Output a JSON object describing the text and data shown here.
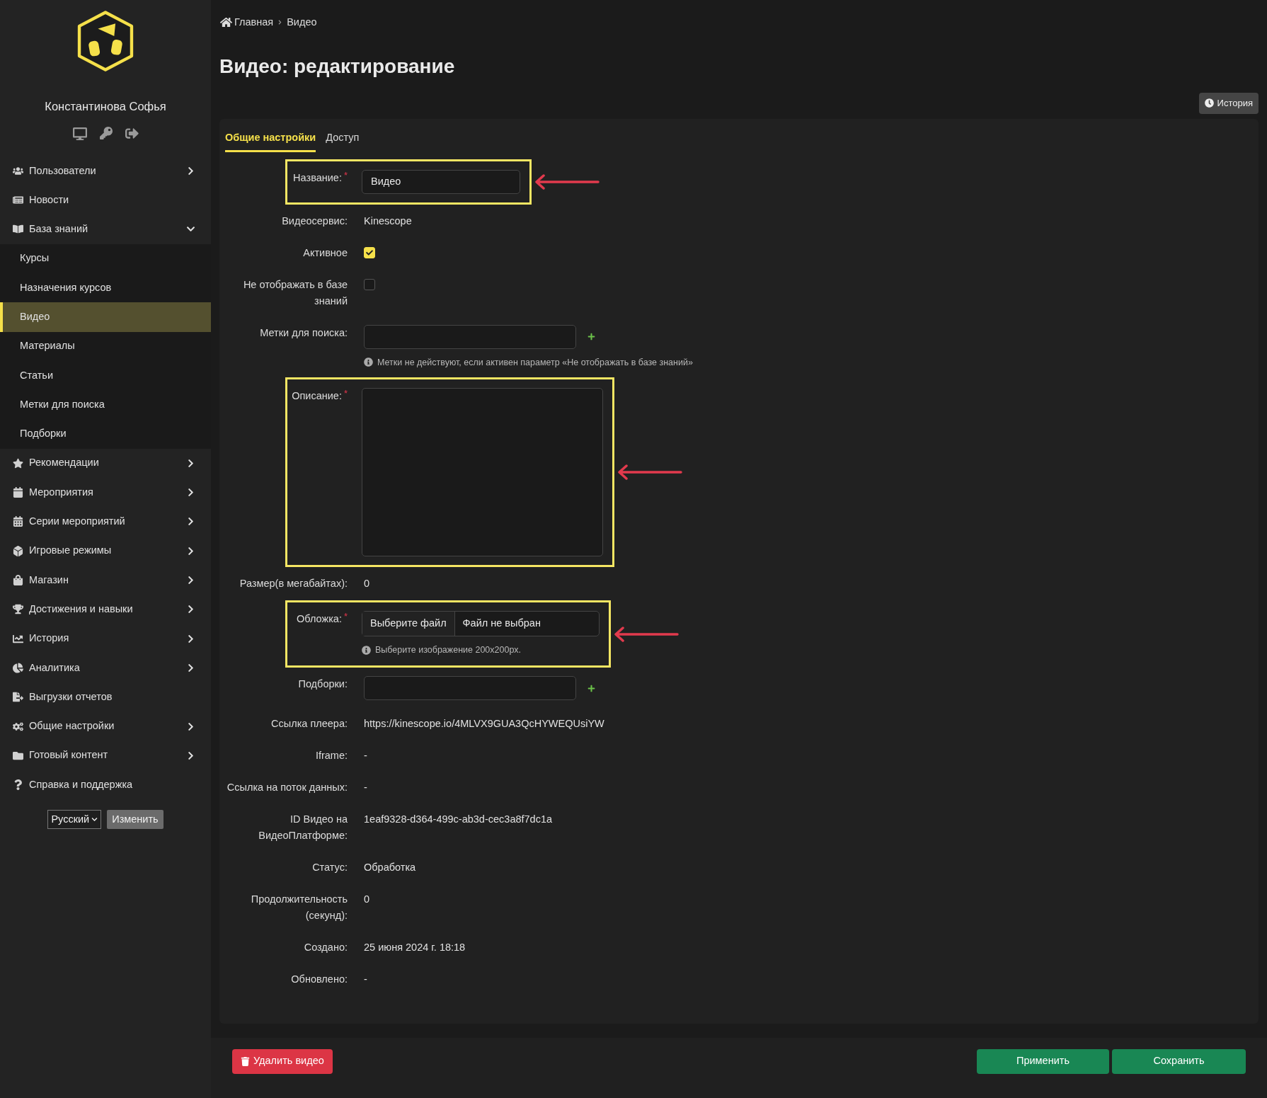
{
  "sidebar": {
    "user_name": "Константинова Софья",
    "menu": [
      {
        "label": "Пользователи",
        "kind": "group",
        "expanded": false
      },
      {
        "label": "Новости",
        "kind": "link"
      },
      {
        "label": "База знаний",
        "kind": "group",
        "expanded": true,
        "children": [
          {
            "label": "Курсы",
            "selected": false
          },
          {
            "label": "Назначения курсов",
            "selected": false
          },
          {
            "label": "Видео",
            "selected": true
          },
          {
            "label": "Материалы",
            "selected": false
          },
          {
            "label": "Статьи",
            "selected": false
          },
          {
            "label": "Метки для поиска",
            "selected": false
          },
          {
            "label": "Подборки",
            "selected": false
          }
        ]
      },
      {
        "label": "Рекомендации",
        "kind": "group",
        "expanded": false
      },
      {
        "label": "Мероприятия",
        "kind": "group",
        "expanded": false
      },
      {
        "label": "Серии мероприятий",
        "kind": "group",
        "expanded": false
      },
      {
        "label": "Игровые режимы",
        "kind": "group",
        "expanded": false
      },
      {
        "label": "Магазин",
        "kind": "group",
        "expanded": false
      },
      {
        "label": "Достижения и навыки",
        "kind": "group",
        "expanded": false
      },
      {
        "label": "История",
        "kind": "group",
        "expanded": false
      },
      {
        "label": "Аналитика",
        "kind": "group",
        "expanded": false
      },
      {
        "label": "Выгрузки отчетов",
        "kind": "link"
      },
      {
        "label": "Общие настройки",
        "kind": "group",
        "expanded": false
      },
      {
        "label": "Готовый контент",
        "kind": "group",
        "expanded": false
      },
      {
        "label": "Справка и поддержка",
        "kind": "link"
      }
    ],
    "language": {
      "value": "Русский"
    },
    "change_button": "Изменить"
  },
  "breadcrumb": [
    {
      "label": "Главная",
      "kind": "home"
    },
    {
      "label": "Видео",
      "kind": "current"
    }
  ],
  "title": "Видео: редактирование",
  "required_mark": "*",
  "history_button": "История",
  "tabs": [
    {
      "label": "Общие настройки",
      "selected": true
    },
    {
      "label": "Доступ",
      "selected": false
    }
  ],
  "fields": [
    {
      "label": "Название:",
      "kind": "input",
      "required": true,
      "highlighted": true,
      "value": "Видео"
    },
    {
      "label": "Видеосервис:",
      "kind": "static",
      "required": false,
      "highlighted": false,
      "value": "Kinescope"
    },
    {
      "label": "Активное",
      "kind": "checkbox",
      "required": false,
      "highlighted": false,
      "checked": true
    },
    {
      "label": "Не отображать в базе знаний",
      "kind": "checkbox",
      "required": false,
      "highlighted": false,
      "checked": false
    },
    {
      "label": "Метки для поиска:",
      "kind": "tags",
      "required": false,
      "highlighted": false,
      "hint": "Метки не действуют, если активен параметр «Не отображать в базе знаний»"
    },
    {
      "label": "Описание:",
      "kind": "textarea",
      "required": true,
      "highlighted": true
    },
    {
      "label": "Размер(в мегабайтах):",
      "kind": "static",
      "required": false,
      "highlighted": false,
      "value": "0"
    },
    {
      "label": "Обложка:",
      "kind": "file",
      "required": true,
      "highlighted": true,
      "button": "Выберите файл",
      "value": "Файл не выбран",
      "hint": "Выберите изображение 200x200px."
    },
    {
      "label": "Подборки:",
      "kind": "tags",
      "required": false,
      "highlighted": false
    },
    {
      "label": "Ссылка плеера:",
      "kind": "static",
      "required": false,
      "highlighted": false,
      "value": "https://kinescope.io/4MLVX9GUA3QcHYWEQUsiYW"
    },
    {
      "label": "Iframe:",
      "kind": "static",
      "required": false,
      "highlighted": false,
      "value": "-"
    },
    {
      "label": "Ссылка на поток данных:",
      "kind": "static",
      "required": false,
      "highlighted": false,
      "value": "-"
    },
    {
      "label": "ID Видео на ВидеоПлатформе:",
      "kind": "static",
      "required": false,
      "highlighted": false,
      "value": "1eaf9328-d364-499c-ab3d-cec3a8f7dc1a"
    },
    {
      "label": "Статус:",
      "kind": "static",
      "required": false,
      "highlighted": false,
      "value": "Обработка"
    },
    {
      "label": "Продолжительность (секунд):",
      "kind": "static",
      "required": false,
      "highlighted": false,
      "value": "0"
    },
    {
      "label": "Создано:",
      "kind": "static",
      "required": false,
      "highlighted": false,
      "value": "25 июня 2024 г. 18:18"
    },
    {
      "label": "Обновлено:",
      "kind": "static",
      "required": false,
      "highlighted": false,
      "value": "-"
    }
  ],
  "footer": {
    "delete_button": "Удалить видео",
    "apply_button": "Применить",
    "save_button": "Сохранить"
  }
}
